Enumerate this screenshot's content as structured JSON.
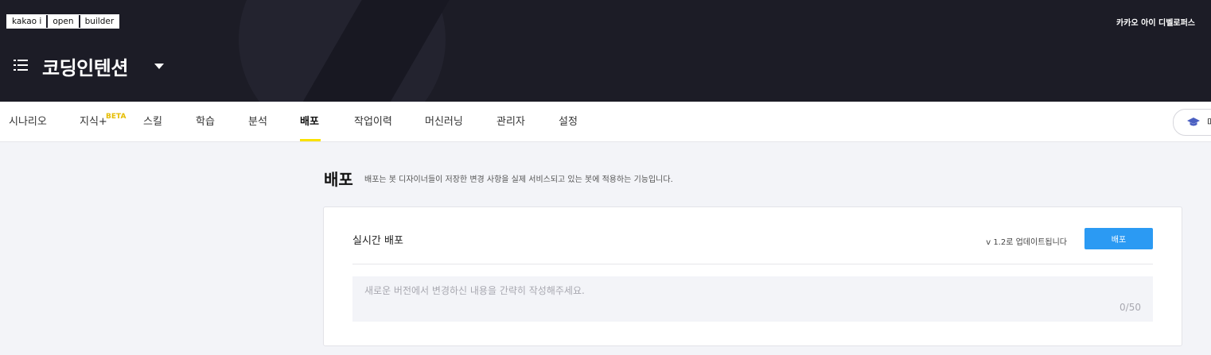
{
  "header": {
    "logo_parts": [
      "kakao i",
      "open",
      "builder"
    ],
    "brand": "카카오 아이 디벨로퍼스",
    "bot_name": "코딩인텐션"
  },
  "nav": {
    "tabs": [
      {
        "label": "시나리오"
      },
      {
        "label": "지식+",
        "badge": "BETA"
      },
      {
        "label": "스킬"
      },
      {
        "label": "학습"
      },
      {
        "label": "분석"
      },
      {
        "label": "배포",
        "active": true
      },
      {
        "label": "작업이력"
      },
      {
        "label": "머신러닝"
      },
      {
        "label": "관리자"
      },
      {
        "label": "설정"
      }
    ],
    "guide_label": "매"
  },
  "page": {
    "title": "배포",
    "description": "배포는 봇 디자이너들이 저장한 변경 사항을 실제 서비스되고 있는 봇에 적용하는 기능입니다."
  },
  "deploy_card": {
    "title": "실시간 배포",
    "version_text": "v 1.2로 업데이트됩니다",
    "button_label": "배포",
    "notes_placeholder": "새로운 버전에서 변경하신 내용을 간략히 작성해주세요.",
    "char_count": "0/50"
  },
  "colors": {
    "header_bg": "#1c1c26",
    "accent_yellow": "#fae100",
    "button_blue": "#2b9af3"
  }
}
